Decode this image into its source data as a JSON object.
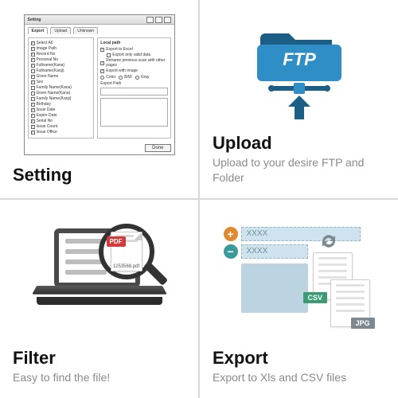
{
  "cards": {
    "setting": {
      "title": "Setting"
    },
    "upload": {
      "title": "Upload",
      "sub": "Upload to your desire FTP and Folder",
      "ftp_label": "FTP"
    },
    "filter": {
      "title": "Filter",
      "sub": "Easy to find the file!",
      "pdf_badge": "PDF",
      "pdf_filename": "1253568.pdf"
    },
    "export": {
      "title": "Export",
      "sub": "Export to Xls and CSV files",
      "strip_text": "XXXX",
      "csv_label": "CSV",
      "jpg_label": "JPG",
      "plus": "+",
      "minus": "−"
    }
  },
  "setting_dialog": {
    "window_title": "Setting",
    "tabs": [
      "Export",
      "Upload",
      "Unknown"
    ],
    "left_header": "Select All",
    "left_items": [
      "Image Path",
      "Record No",
      "Personal No",
      "Fullname(Kana)",
      "Fullname(Kanji)",
      "Given Name",
      "Sex",
      "Family Name(Kana)",
      "Given Name(Kana)",
      "Family Name(Kanji)",
      "Birthday",
      "Issue Date",
      "Expire Date",
      "Serial No",
      "Issue Count",
      "Issue Office"
    ],
    "right_header": "Local path",
    "right_checks": [
      "Export to Excel",
      "Export only valid data",
      "Rename previous scan with other pages",
      "Export with image"
    ],
    "right_radios": [
      "Color",
      "B/W",
      "Gray"
    ],
    "right_option": "Export Path",
    "done_btn": "Done"
  }
}
